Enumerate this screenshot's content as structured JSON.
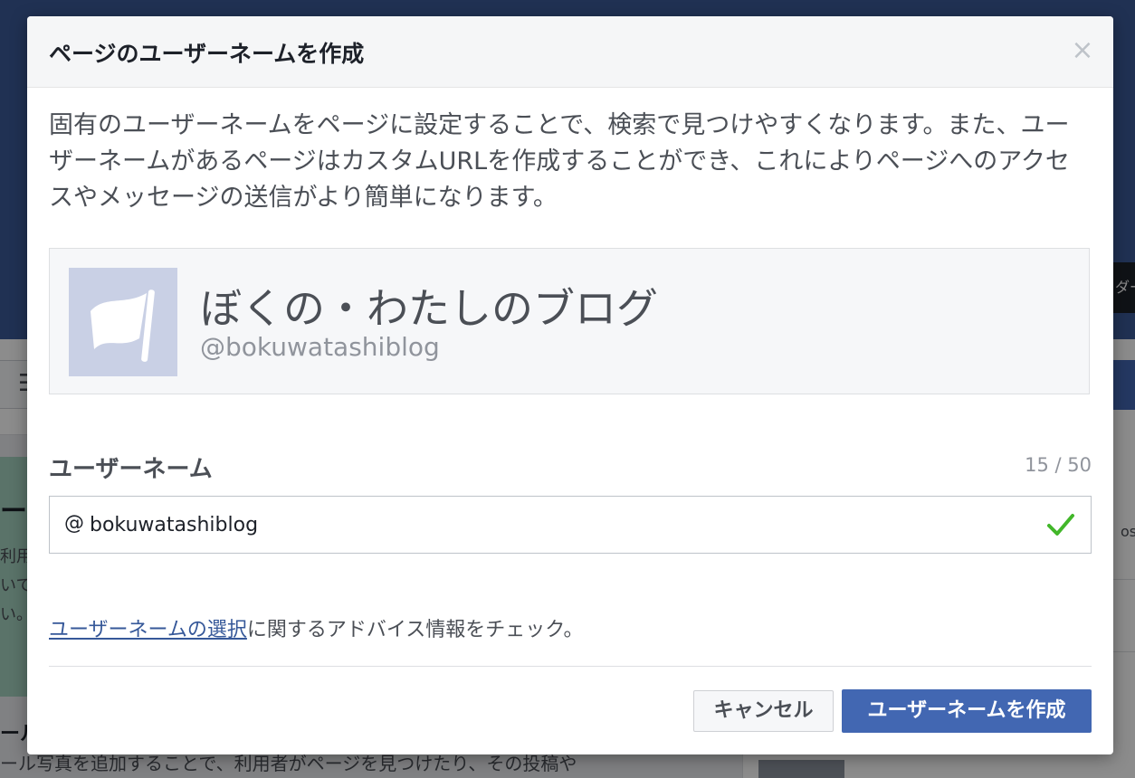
{
  "background": {
    "left_heading": "ージ",
    "left_text_lines": [
      "利用",
      "いて",
      "い。"
    ],
    "bottom_heading": "ール",
    "bottom_text": "ール写真を追加することで、利用者がページを見つけたり、その投稿や",
    "right_badge": "ダー",
    "right_snippet": "os"
  },
  "dialog": {
    "title": "ページのユーザーネームを作成",
    "close_label": "×",
    "description": "固有のユーザーネームをページに設定することで、検索で見つけやすくなります。また、ユーザーネームがあるページはカスタムURLを作成することができ、これによりページへのアクセスやメッセージの送信がより簡単になります。",
    "preview": {
      "page_name": "ぼくの・わたしのブログ",
      "handle": "@bokuwatashiblog",
      "avatar_icon": "flag-icon"
    },
    "username_field": {
      "label": "ユーザーネーム",
      "counter": "15 / 50",
      "prefix": "@",
      "value": "bokuwatashiblog",
      "status_icon": "check-icon",
      "status_color": "#42b72a"
    },
    "advice": {
      "link_text": "ユーザーネームの選択",
      "rest_text": "に関するアドバイス情報をチェック。"
    },
    "buttons": {
      "cancel": "キャンセル",
      "create": "ユーザーネームを作成"
    }
  },
  "colors": {
    "primary": "#4267b2",
    "link": "#365899",
    "success": "#42b72a"
  }
}
